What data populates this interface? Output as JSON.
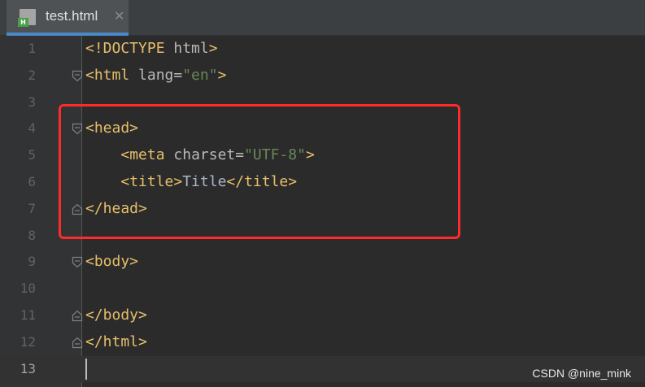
{
  "tab": {
    "title": "test.html",
    "close": "✕",
    "icon": "html-file-icon",
    "icon_badge": "H"
  },
  "editor": {
    "current_line": 13,
    "lines": [
      {
        "n": "1",
        "tokens": [
          [
            "t",
            "<!DOCTYPE "
          ],
          [
            "a",
            "html"
          ],
          [
            "t",
            ">"
          ]
        ]
      },
      {
        "n": "2",
        "fold": "open",
        "tokens": [
          [
            "t",
            "<html "
          ],
          [
            "a",
            "lang="
          ],
          [
            "s",
            "\"en\""
          ],
          [
            "t",
            ">"
          ]
        ]
      },
      {
        "n": "3",
        "tokens": []
      },
      {
        "n": "4",
        "fold": "open",
        "tokens": [
          [
            "t",
            "<head>"
          ]
        ]
      },
      {
        "n": "5",
        "tokens": [
          [
            "p",
            "    "
          ],
          [
            "t",
            "<meta "
          ],
          [
            "a",
            "charset="
          ],
          [
            "s",
            "\"UTF-8\""
          ],
          [
            "t",
            ">"
          ]
        ]
      },
      {
        "n": "6",
        "tokens": [
          [
            "p",
            "    "
          ],
          [
            "t",
            "<title>"
          ],
          [
            "p",
            "Title"
          ],
          [
            "t",
            "</title>"
          ]
        ]
      },
      {
        "n": "7",
        "fold": "close",
        "tokens": [
          [
            "t",
            "</head>"
          ]
        ]
      },
      {
        "n": "8",
        "tokens": []
      },
      {
        "n": "9",
        "fold": "open",
        "tokens": [
          [
            "t",
            "<body>"
          ]
        ]
      },
      {
        "n": "10",
        "tokens": []
      },
      {
        "n": "11",
        "fold": "close",
        "tokens": [
          [
            "t",
            "</body>"
          ]
        ]
      },
      {
        "n": "12",
        "fold": "close",
        "tokens": [
          [
            "t",
            "</html>"
          ]
        ]
      },
      {
        "n": "13",
        "caret": true,
        "tokens": []
      }
    ]
  },
  "colors": {
    "tag": "#e8bf6a",
    "attribute": "#bababa",
    "string": "#6a8759",
    "text": "#a9b7c6",
    "highlight": "#ff2a2a"
  },
  "watermark": "CSDN @nine_mink"
}
